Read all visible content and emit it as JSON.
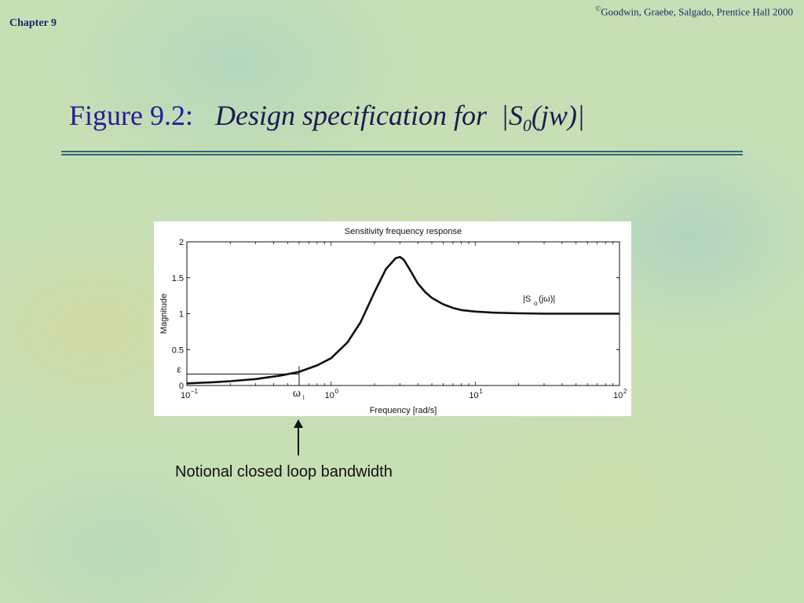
{
  "header": {
    "chapter": "Chapter 9",
    "copyright_symbol": "©",
    "copyright": "Goodwin, Graebe, Salgado, Prentice Hall 2000"
  },
  "slide": {
    "title_figure": "Figure 9.2:",
    "title_desc": "Design specification for",
    "title_symbol_open": "|S",
    "title_symbol_sub": "0",
    "title_symbol_close": "(jw)|",
    "caption": "Notional closed loop bandwidth"
  },
  "chart_data": {
    "type": "line",
    "title": "Sensitivity frequency response",
    "xlabel": "Frequency  [rad/s]",
    "ylabel": "Magnitude",
    "x_scale": "log",
    "xlim": [
      0.1,
      100
    ],
    "ylim": [
      0,
      2
    ],
    "grid": false,
    "x_ticks": [
      {
        "value": 0.1,
        "base": "10",
        "exp": "−1"
      },
      {
        "value": 1,
        "base": "10",
        "exp": "0"
      },
      {
        "value": 10,
        "base": "10",
        "exp": "1"
      },
      {
        "value": 100,
        "base": "10",
        "exp": "2"
      }
    ],
    "y_ticks": [
      {
        "value": 0,
        "label": "0"
      },
      {
        "value": 0.5,
        "label": "0.5"
      },
      {
        "value": 1,
        "label": "1"
      },
      {
        "value": 1.5,
        "label": "1.5"
      },
      {
        "value": 2,
        "label": "2"
      }
    ],
    "series": [
      {
        "name": "|So(jω)|",
        "x": [
          0.1,
          0.15,
          0.2,
          0.3,
          0.45,
          0.6,
          0.8,
          1.0,
          1.3,
          1.6,
          2.0,
          2.4,
          2.8,
          3.0,
          3.2,
          3.5,
          4.0,
          4.5,
          5.0,
          6.0,
          7.0,
          8.0,
          10,
          13,
          16,
          20,
          30,
          50,
          100
        ],
        "values": [
          0.03,
          0.045,
          0.06,
          0.09,
          0.14,
          0.19,
          0.28,
          0.38,
          0.6,
          0.88,
          1.3,
          1.62,
          1.77,
          1.79,
          1.75,
          1.62,
          1.42,
          1.3,
          1.22,
          1.13,
          1.08,
          1.05,
          1.03,
          1.015,
          1.01,
          1.005,
          1.0,
          1.0,
          1.0
        ]
      }
    ],
    "annotations": {
      "series_label": {
        "main": "|S",
        "sub": "o",
        "rest": "(jω)|"
      },
      "epsilon": {
        "label": "ε",
        "value": 0.16
      },
      "omega_l": {
        "label": "ω",
        "sub": "l",
        "value": 0.6
      }
    }
  }
}
